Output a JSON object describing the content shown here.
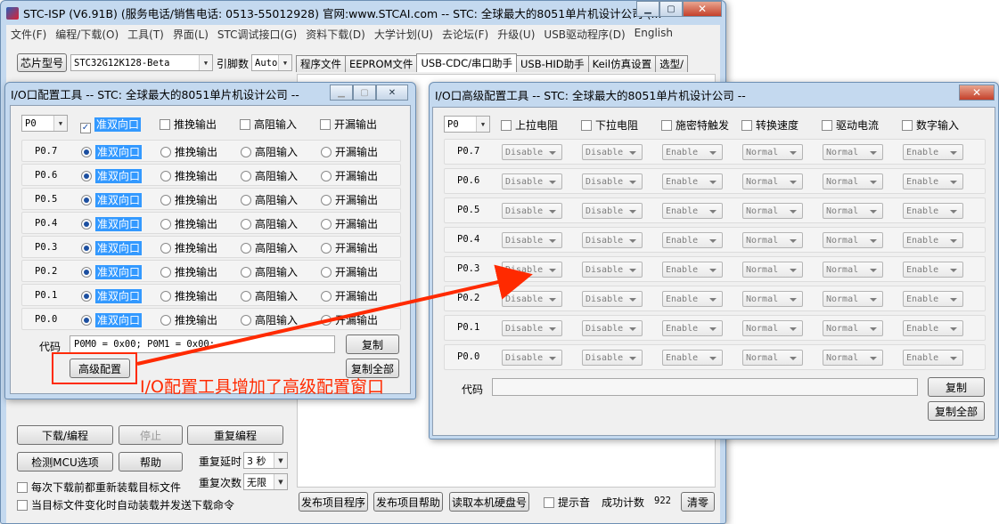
{
  "main_window": {
    "title": "STC-ISP (V6.91B) (服务电话/销售电话: 0513-55012928) 官网:www.STCAI.com  -- STC: 全球最大的8051单片机设计公司 (...",
    "menu": [
      "文件(F)",
      "编程/下载(O)",
      "工具(T)",
      "界面(L)",
      "STC调试接口(G)",
      "资料下载(D)",
      "大学计划(U)",
      "去论坛(F)",
      "升级(U)",
      "USB驱动程序(D)",
      "English"
    ],
    "chip_label": "芯片型号",
    "chip_value": "STC32G12K128-Beta",
    "pin_label": "引脚数",
    "pin_value": "Auto",
    "tabs": [
      "程序文件",
      "EEPROM文件",
      "USB-CDC/串口助手",
      "USB-HID助手",
      "Keil仿真设置",
      "选型/"
    ],
    "download_button": "下载/编程",
    "stop_button": "停止",
    "reprogram_button": "重复编程",
    "check_mcu_button": "检测MCU选项",
    "help_button": "帮助",
    "repeat_delay_label": "重复延时",
    "repeat_delay_value": "3 秒",
    "repeat_count_label": "重复次数",
    "repeat_count_value": "无限",
    "reload_each_download": "每次下载前都重新装载目标文件",
    "auto_send_on_change": "当目标文件变化时自动装载并发送下载命令",
    "publish_program_button": "发布项目程序",
    "publish_help_button": "发布项目帮助",
    "read_disk_button": "读取本机硬盘号",
    "sound_label": "提示音",
    "success_count_label": "成功计数",
    "success_count_value": "922",
    "clear_button": "清零"
  },
  "io_dialog": {
    "title": "I/O口配置工具 -- STC: 全球最大的8051单片机设计公司 --",
    "port": "P0",
    "headers": [
      "准双向口",
      "推挽输出",
      "高阻输入",
      "开漏输出"
    ],
    "pins": [
      "P0.7",
      "P0.6",
      "P0.5",
      "P0.4",
      "P0.3",
      "P0.2",
      "P0.1",
      "P0.0"
    ],
    "mode_options": [
      "准双向口",
      "推挽输出",
      "高阻输入",
      "开漏输出"
    ],
    "code_label": "代码",
    "code_value": "P0M0 = 0x00;  P0M1 = 0x00;",
    "copy_button": "复制",
    "copy_all_button": "复制全部",
    "advanced_button": "高级配置"
  },
  "advanced_dialog": {
    "title": "I/O口高级配置工具 -- STC: 全球最大的8051单片机设计公司 --",
    "port": "P0",
    "headers": [
      "上拉电阻",
      "下拉电阻",
      "施密特触发",
      "转换速度",
      "驱动电流",
      "数字输入"
    ],
    "pins": [
      "P0.7",
      "P0.6",
      "P0.5",
      "P0.4",
      "P0.3",
      "P0.2",
      "P0.1",
      "P0.0"
    ],
    "values": [
      "Disable",
      "Disable",
      "Enable",
      "Normal",
      "Normal",
      "Enable"
    ],
    "code_label": "代码",
    "copy_button": "复制",
    "copy_all_button": "复制全部"
  },
  "annotation": {
    "text": "I/O配置工具增加了高级配置窗口",
    "color": "#ff2a00"
  },
  "colors": {
    "window_frame": "#c4d9ef",
    "highlight": "#3399ff",
    "arrow": "#ff2a00"
  }
}
